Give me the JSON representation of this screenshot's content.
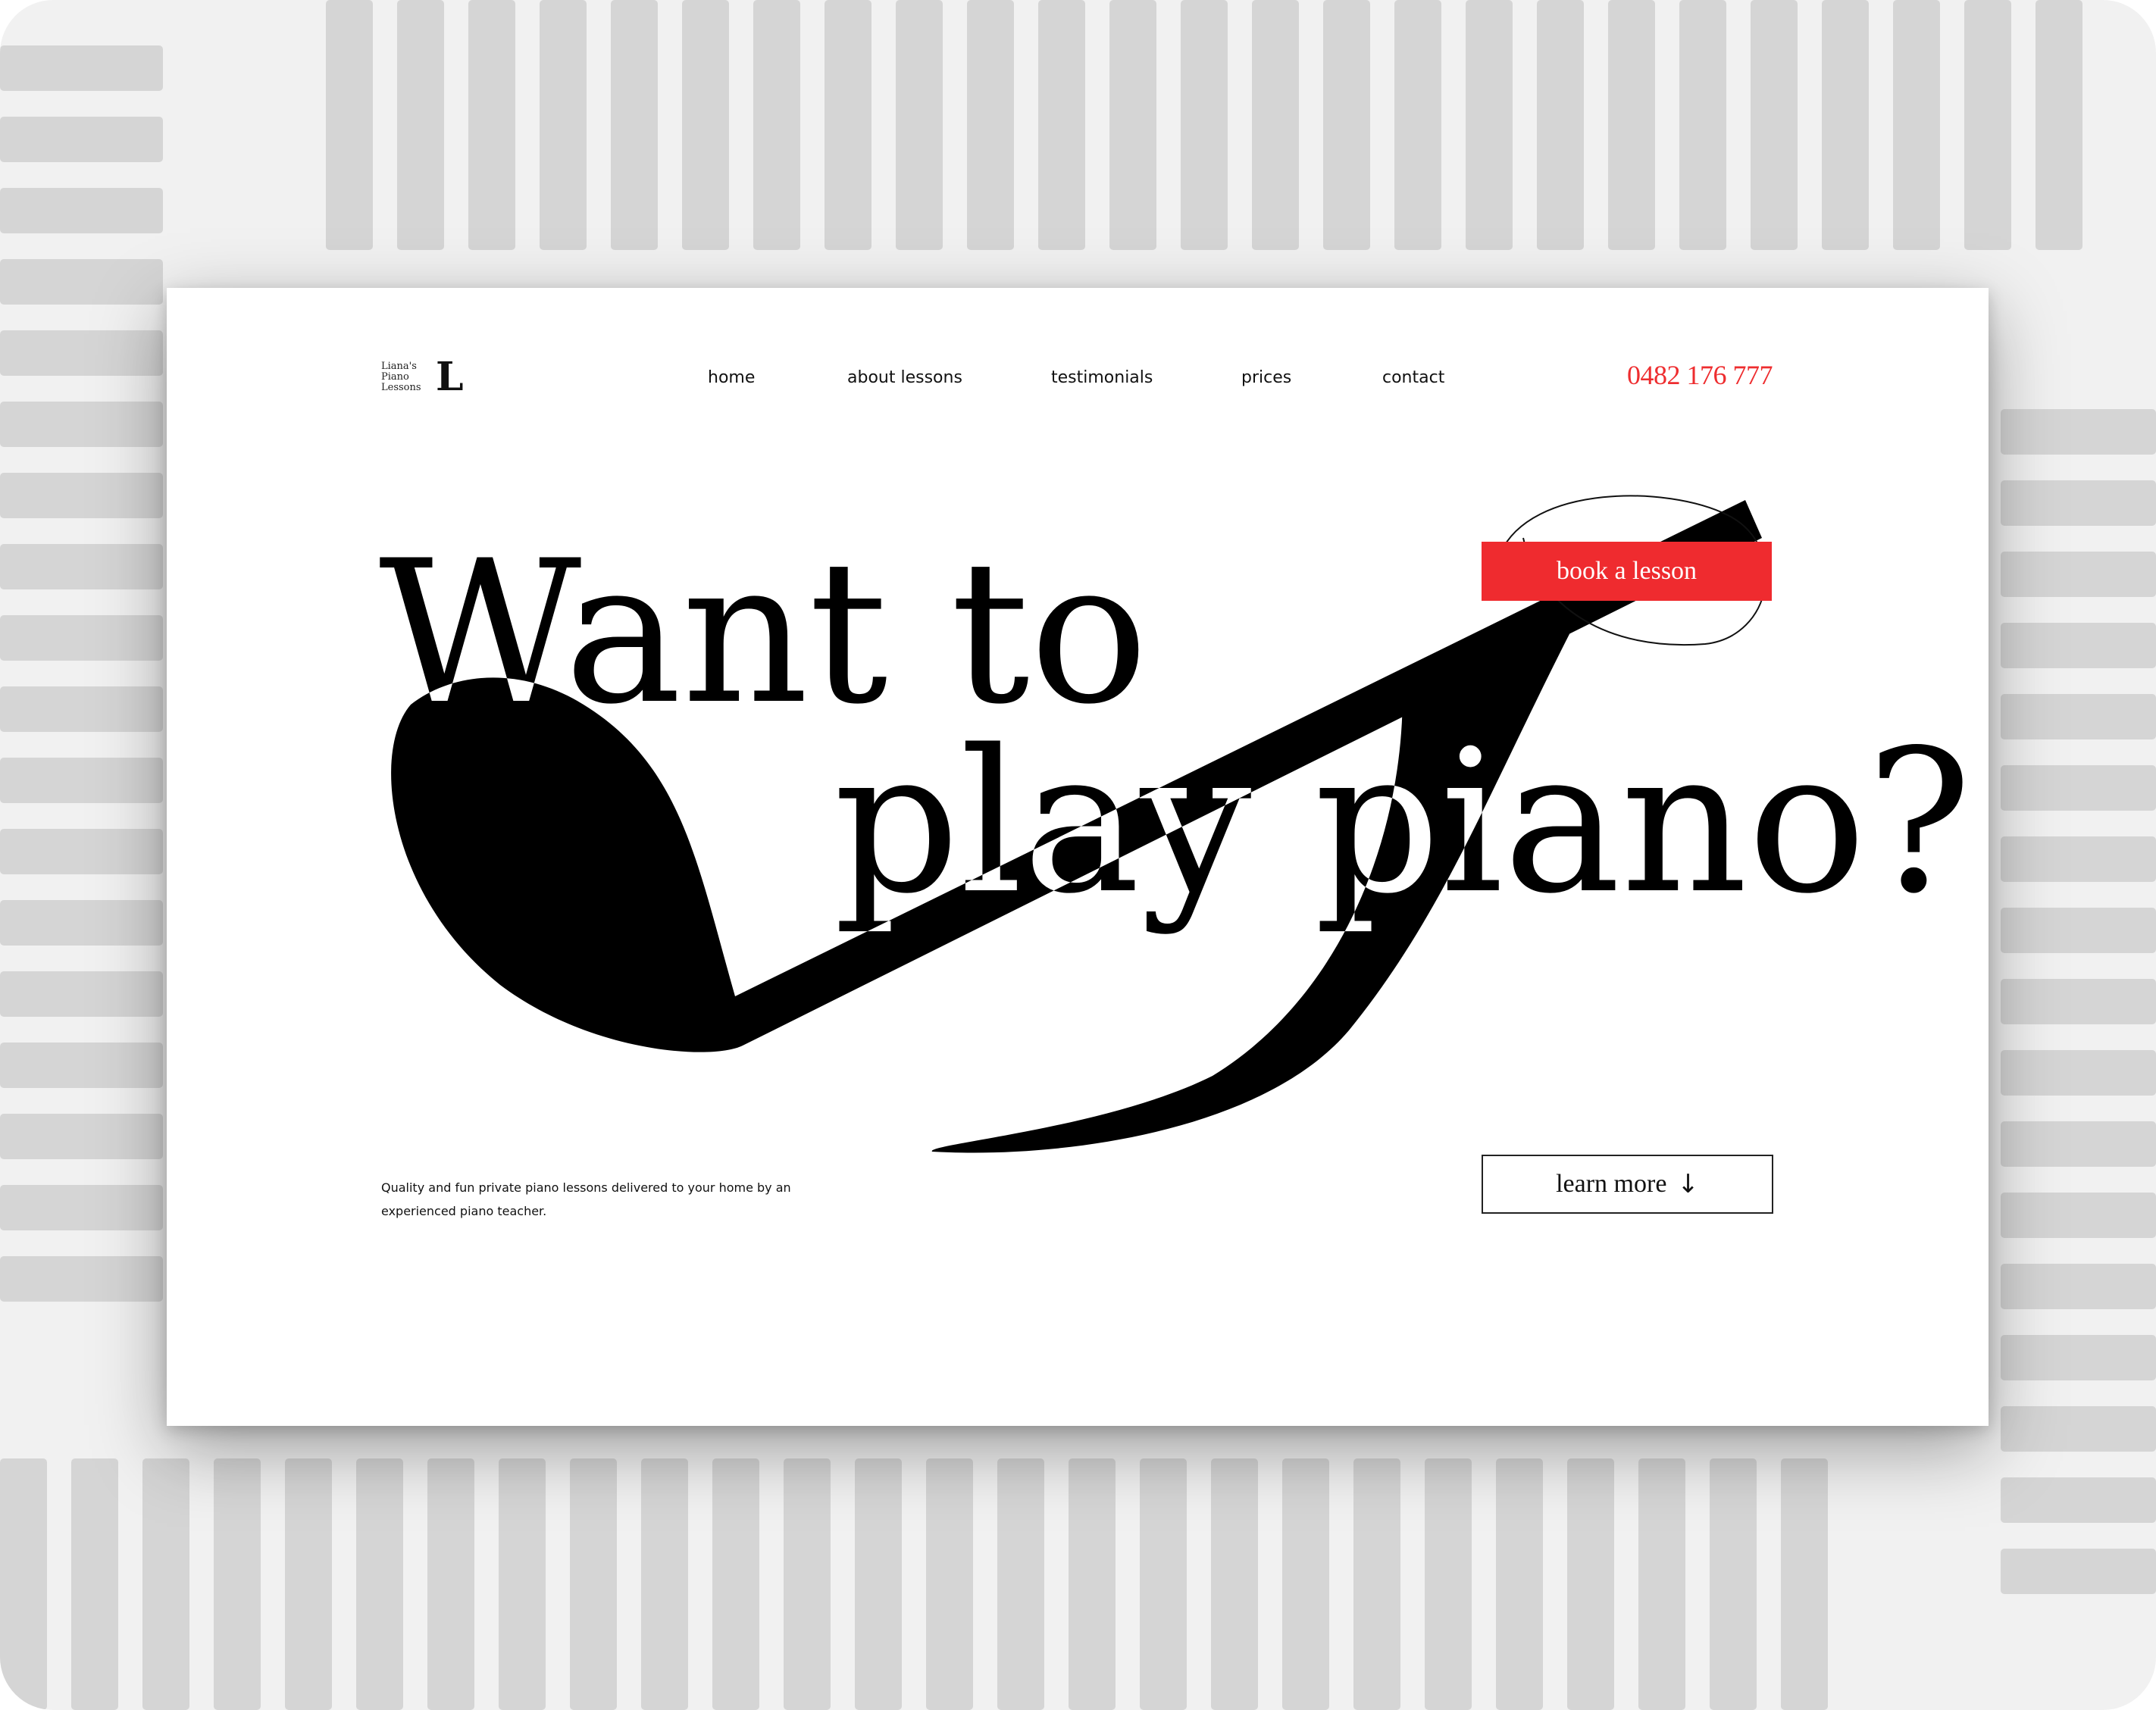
{
  "logo": {
    "lines": [
      "Liana's",
      "Piano",
      "Lessons"
    ],
    "mark": "L"
  },
  "nav": {
    "items": [
      {
        "label": "home"
      },
      {
        "label": "about lessons"
      },
      {
        "label": "testimonials"
      },
      {
        "label": "prices"
      },
      {
        "label": "contact"
      }
    ]
  },
  "phone": "0482 176 777",
  "hero": {
    "line1": "Want to",
    "line2": "play piano?"
  },
  "cta": {
    "book_label": "book a lesson",
    "learn_label": "learn more"
  },
  "tagline": "Quality and fun private piano lessons delivered to your home by an experienced piano teacher.",
  "colors": {
    "accent": "#ee2d2f",
    "ink": "#000000",
    "key_gray": "#d5d5d5"
  },
  "icons": {
    "learn_more": "arrow-down-icon"
  }
}
